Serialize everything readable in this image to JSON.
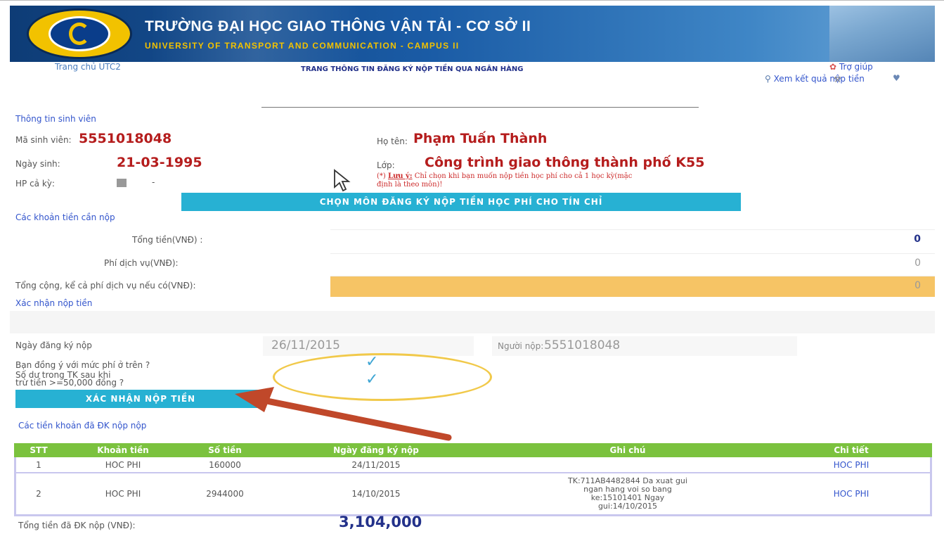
{
  "header": {
    "title_vi": "TRƯỜNG ĐẠI HỌC GIAO THÔNG VẬN TẢI - CƠ SỞ II",
    "title_en": "UNIVERSITY OF TRANSPORT AND COMMUNICATION - CAMPUS II"
  },
  "nav": {
    "home": "Trang chủ UTC2",
    "page_title": "TRANG THÔNG TIN ĐĂNG KÝ NỘP TIỀN QUA NGÂN HÀNG",
    "help": "Trợ giúp",
    "view_results": "Xem kết quả nộp tiền"
  },
  "student": {
    "section": "Thông tin sinh viên",
    "id_label": "Mã sinh viên:",
    "id": "5551018048",
    "name_label": "Họ tên:",
    "name": "Phạm Tuấn Thành",
    "dob_label": "Ngày sinh:",
    "dob": "21-03-1995",
    "class_label": "Lớp:",
    "class": "Công trình giao thông thành phố  K55",
    "hp_label": "HP cả kỳ:",
    "hp_dash": "-",
    "note_prefix": "(*)",
    "note_bold": "Lưu ý:",
    "note_line1": "Chỉ chọn khi bạn muốn nộp tiền học phí cho cả 1 học kỳ(mặc",
    "note_line2": "định là theo môn)!"
  },
  "choose_button": "CHỌN MÔN ĐĂNG KÝ NỘP TIỀN HỌC PHÍ CHO TÍN CHỈ",
  "amounts": {
    "section": "Các khoản tiền cần nộp",
    "total_label": "Tổng tiền(VNĐ) :",
    "total_value": "0",
    "fee_label": "Phí dịch vụ(VNĐ):",
    "fee_value": "0",
    "grand_label": "Tổng cộng, kể cả phí dịch vụ nếu có(VNĐ):",
    "grand_value": "0"
  },
  "confirm": {
    "section": "Xác nhận nộp tiền",
    "date_label": "Ngày đăng ký nộp",
    "date_value": "26/11/2015",
    "payer_label": "Người nộp:",
    "payer_value": "5551018048",
    "agree_label": "Bạn đồng ý với mức phí ở trên ?",
    "balance_line1": "Số dư trong TK sau khi",
    "balance_line2": "trừ tiền >=50,000 đồng ?",
    "button": "XÁC NHẬN NỘP TIỀN",
    "check_glyph": "✓"
  },
  "history": {
    "section": "Các tiền khoản đã ĐK nộp nộp",
    "headers": [
      "STT",
      "Khoản tiền",
      "Số tiền",
      "Ngày đăng ký nộp",
      "Ghi chú",
      "Chi tiết"
    ],
    "rows": [
      {
        "stt": "1",
        "item": "HOC PHI",
        "amount": "160000",
        "date": "24/11/2015",
        "note": [
          "",
          "",
          "",
          ""
        ],
        "detail": "HOC PHI"
      },
      {
        "stt": "2",
        "item": "HOC PHI",
        "amount": "2944000",
        "date": "14/10/2015",
        "note": [
          "TK:711AB4482844 Da xuat gui",
          "ngan hang voi so bang",
          "ke:15101401 Ngay",
          "gui:14/10/2015"
        ],
        "detail": "HOC PHI"
      }
    ],
    "sum_label": "Tổng tiền đã ĐK nộp (VNĐ):",
    "sum_value": "3,104,000"
  },
  "colors": {
    "accent": "#27b1d3",
    "table_header": "#7bc23e",
    "total_row": "#f6c465",
    "annotation_arrow": "#c0482a",
    "annotation_ellipse": "#f1c94a"
  }
}
